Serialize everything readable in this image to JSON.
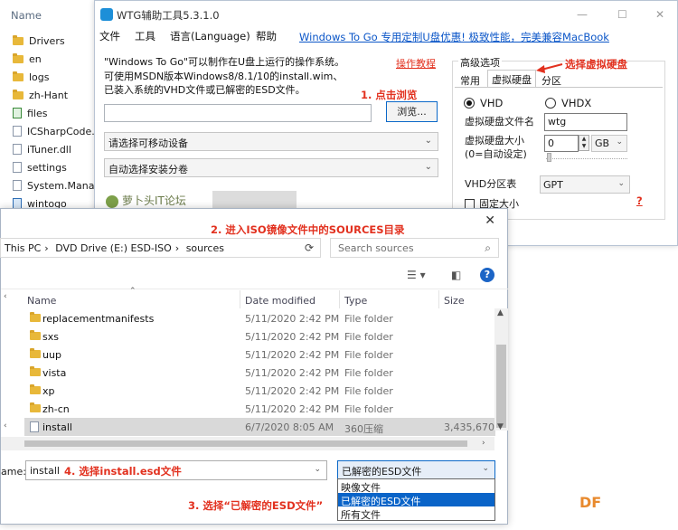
{
  "bg_explorer": {
    "header": "Name",
    "items": [
      {
        "label": "Drivers",
        "icon": "folder"
      },
      {
        "label": "en",
        "icon": "folder"
      },
      {
        "label": "logs",
        "icon": "folder"
      },
      {
        "label": "zh-Hant",
        "icon": "folder"
      },
      {
        "label": "files",
        "icon": "file-green"
      },
      {
        "label": "ICSharpCode.S",
        "icon": "file"
      },
      {
        "label": "iTuner.dll",
        "icon": "file"
      },
      {
        "label": "settings",
        "icon": "file"
      },
      {
        "label": "System.Manag",
        "icon": "file"
      },
      {
        "label": "wintogo",
        "icon": "file-blue"
      }
    ]
  },
  "wtg": {
    "title": "WTG辅助工具5.3.1.0",
    "menu": [
      "文件",
      "工具",
      "语言(Language)",
      "帮助"
    ],
    "promo_link": "Windows To Go 专用定制U盘优惠! 极致性能，完美兼容MacBook",
    "description": [
      "\"Windows To Go\"可以制作在U盘上运行的操作系统。",
      "可使用MSDN版本Windows8/8.1/10的install.wim、",
      "已装入系统的VHD文件或已解密的ESD文件。"
    ],
    "tutorial_link": "操作教程",
    "annotation_browse": "1. 点击浏览",
    "browse_button": "浏览...",
    "device_combo": "请选择可移动设备",
    "volume_combo": "自动选择安装分卷",
    "logo_text": "萝卜头IT论坛",
    "advanced": {
      "title": "高级选项",
      "tabs": [
        "常用",
        "虚拟硬盘",
        "分区"
      ],
      "annotation": "选择虚拟硬盘",
      "radio_vhd": "VHD",
      "radio_vhdx": "VHDX",
      "vhd_name_label": "虚拟硬盘文件名",
      "vhd_name_value": "wtg",
      "vhd_size_label_1": "虚拟硬盘大小",
      "vhd_size_label_2": "(0=自动设定)",
      "vhd_size_value": "0",
      "vhd_size_unit": "GB",
      "partition_table_label": "VHD分区表",
      "partition_table_value": "GPT",
      "fixed_size_label": "固定大小",
      "help_mark": "?"
    }
  },
  "dialog": {
    "annotation_sources": "2. 进入ISO镜像文件中的SOURCES目录",
    "breadcrumb": [
      "This PC",
      "DVD Drive (E:) ESD-ISO",
      "sources"
    ],
    "search_placeholder": "Search sources",
    "columns": {
      "name": "Name",
      "date": "Date modified",
      "type": "Type",
      "size": "Size"
    },
    "rows": [
      {
        "name": "replacementmanifests",
        "date": "5/11/2020 2:42 PM",
        "type": "File folder",
        "size": ""
      },
      {
        "name": "sxs",
        "date": "5/11/2020 2:42 PM",
        "type": "File folder",
        "size": ""
      },
      {
        "name": "uup",
        "date": "5/11/2020 2:42 PM",
        "type": "File folder",
        "size": ""
      },
      {
        "name": "vista",
        "date": "5/11/2020 2:42 PM",
        "type": "File folder",
        "size": ""
      },
      {
        "name": "xp",
        "date": "5/11/2020 2:42 PM",
        "type": "File folder",
        "size": ""
      },
      {
        "name": "zh-cn",
        "date": "5/11/2020 2:42 PM",
        "type": "File folder",
        "size": ""
      },
      {
        "name": "install",
        "date": "6/7/2020 8:05 AM",
        "type": "360压缩",
        "size": "3,435,670"
      }
    ],
    "filename_label": "ame:",
    "filename_value": "install",
    "annotation_filename": "4. 选择install.esd文件",
    "filetype_selected": "已解密的ESD文件",
    "filetype_options": [
      "映像文件",
      "已解密的ESD文件",
      "所有文件"
    ],
    "annotation_filetype": "3. 选择“已解密的ESD文件”"
  },
  "watermark": "DF",
  "colors": {
    "annotation": "#e2311f",
    "link": "#0b56c8",
    "folder": "#e8b83a",
    "selection": "#0a64c8"
  }
}
